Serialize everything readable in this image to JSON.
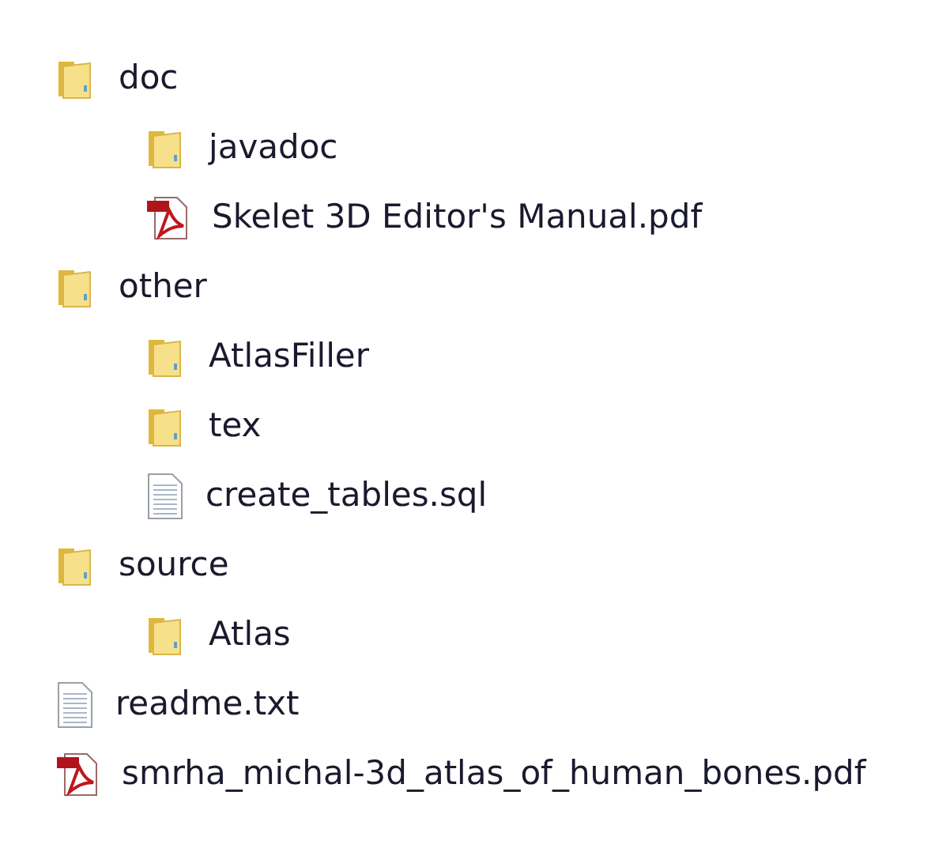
{
  "tree": [
    {
      "kind": "folder",
      "label": "doc",
      "children": [
        {
          "kind": "folder",
          "label": "javadoc"
        },
        {
          "kind": "pdf",
          "label": "Skelet 3D Editor's Manual.pdf"
        }
      ]
    },
    {
      "kind": "folder",
      "label": "other",
      "children": [
        {
          "kind": "folder",
          "label": "AtlasFiller"
        },
        {
          "kind": "folder",
          "label": "tex"
        },
        {
          "kind": "text",
          "label": "create_tables.sql"
        }
      ]
    },
    {
      "kind": "folder",
      "label": "source",
      "children": [
        {
          "kind": "folder",
          "label": "Atlas"
        }
      ]
    },
    {
      "kind": "text",
      "label": "readme.txt"
    },
    {
      "kind": "pdf",
      "label": "smrha_michal-3d_atlas_of_human_bones.pdf"
    }
  ]
}
